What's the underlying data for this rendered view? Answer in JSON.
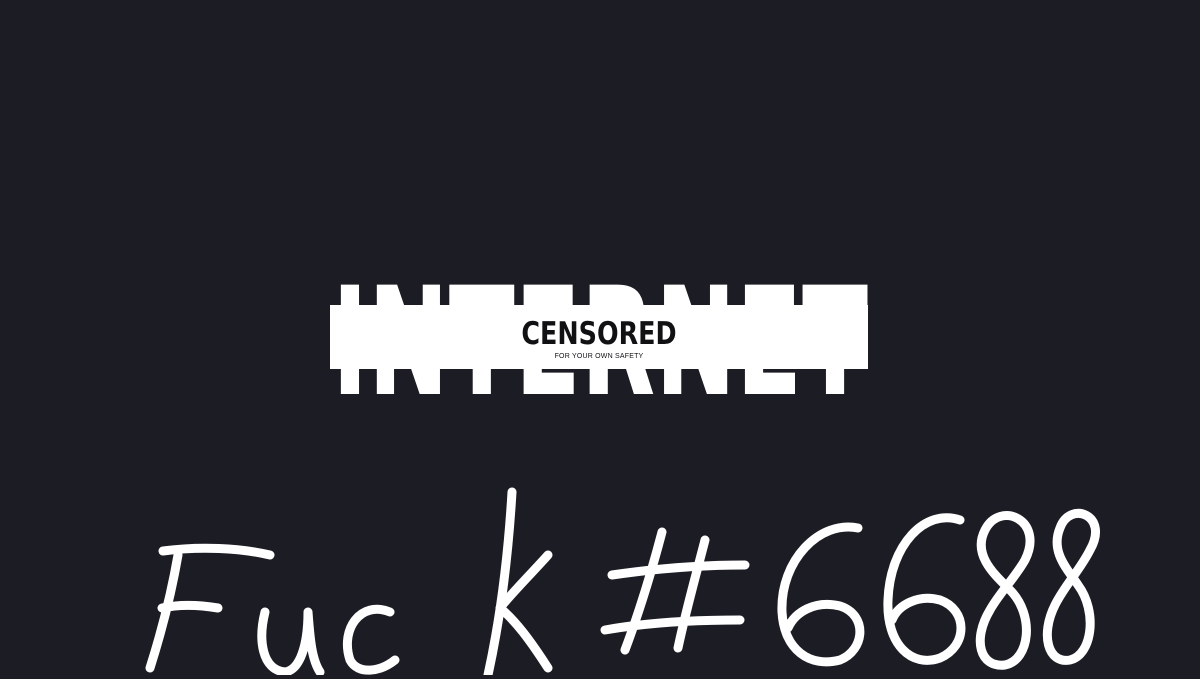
{
  "logo": {
    "big_word": "INTERNET",
    "stamp": "CENSORED",
    "tagline": "FOR YOUR OWN SAFETY"
  },
  "handwritten": {
    "text": "Fuck #6688"
  },
  "colors": {
    "background": "#1c1c24",
    "foreground": "#ffffff",
    "stamp_text": "#111114"
  }
}
